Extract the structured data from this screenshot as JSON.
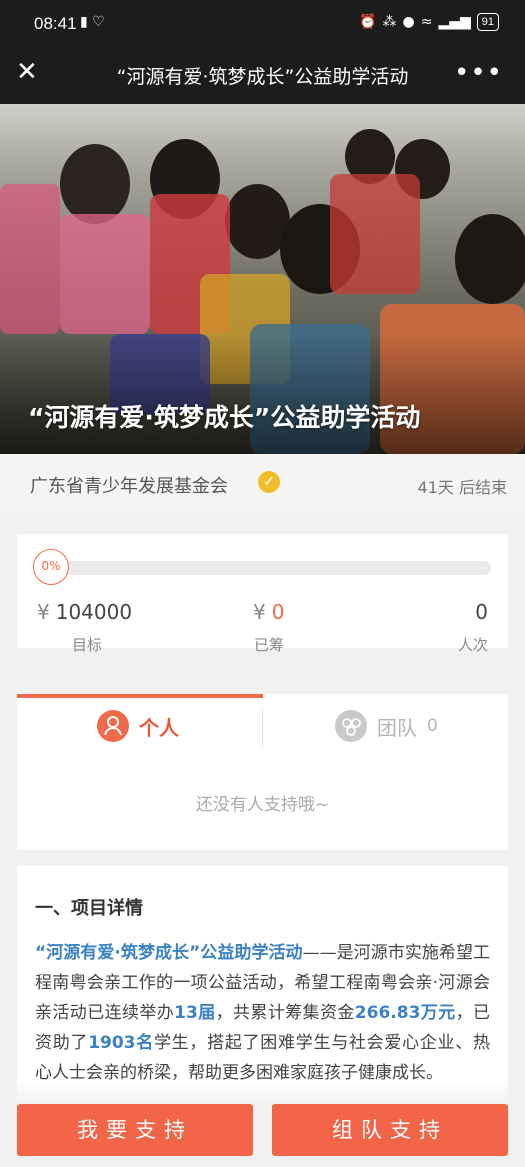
{
  "status_bar": {
    "time": "08:41",
    "battery": "91"
  },
  "title_bar": {
    "title": "“河源有爱·筑梦成长”公益助学活动",
    "close_icon": "close-icon",
    "more_icon": "more-icon"
  },
  "hero": {
    "heading": "“河源有爱·筑梦成长”公益助学活动"
  },
  "organizer": {
    "name": "广东省青少年发展基金会",
    "days_left": "41天 后结束"
  },
  "progress": {
    "percent_label": "0%",
    "fraction": 0,
    "target_value": "104000",
    "target_label": "目标",
    "raised_value": "0",
    "raised_label": "已筹",
    "count_value": "0",
    "count_label": "人次",
    "currency": "¥"
  },
  "tabs": {
    "person": {
      "label": "个人"
    },
    "team": {
      "label": "团队",
      "count": "0"
    },
    "empty_message": "还没有人支持哦~"
  },
  "details": {
    "section_title": "一、项目详情",
    "p_title": "“河源有爱·筑梦成长”公益助学活动",
    "p_t1": "——是河源市实施希望工程南粤会亲工作的一项公益活动，希望工程南粤会亲·河源会亲活动已连续举办",
    "p_n1": "13届",
    "p_t2": "，共累计筹集资金",
    "p_n2": "266.83万元",
    "p_t3": "，已资助了",
    "p_n3": "1903名",
    "p_t4": "学生，搭起了困难学生与社会爱心企业、热心人士会亲的桥梁，帮助更多困难家庭孩子健康成长。"
  },
  "buttons": {
    "support": "我要支持",
    "team_support": "组队支持"
  },
  "colors": {
    "accent": "#f26549",
    "highlight": "#3b82c4",
    "verified": "#f1bd2a"
  }
}
